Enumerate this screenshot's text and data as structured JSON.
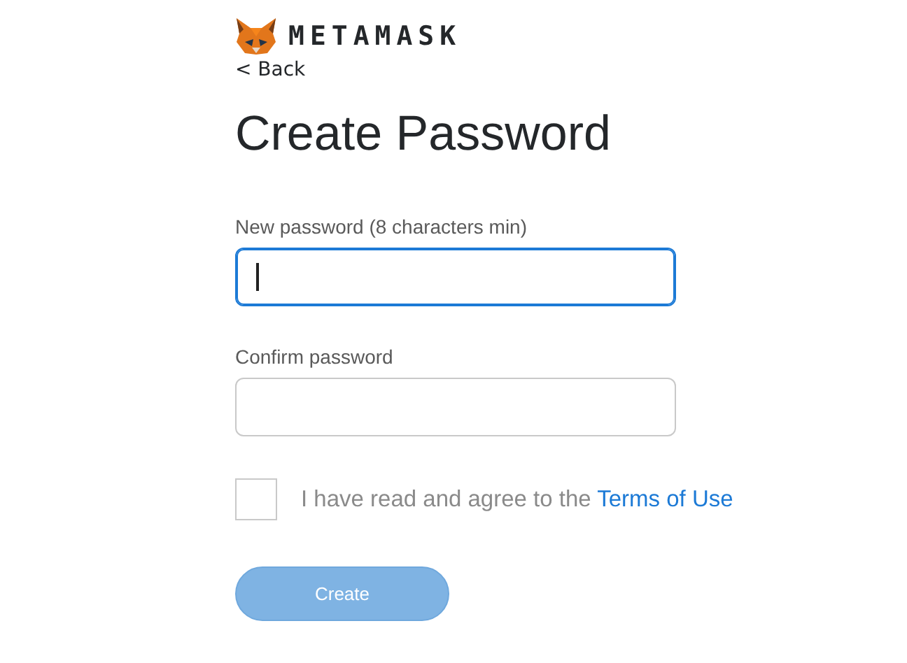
{
  "brand": {
    "name": "METAMASK"
  },
  "back": {
    "label": "< Back"
  },
  "title": "Create Password",
  "fields": [
    {
      "label": "New password (8 characters min)",
      "focused": true
    },
    {
      "label": "Confirm password",
      "focused": false
    }
  ],
  "agreement": {
    "checked": false,
    "text": "I have read and agree to the ",
    "link": "Terms of Use"
  },
  "create_button": {
    "label": "Create",
    "disabled": true
  }
}
